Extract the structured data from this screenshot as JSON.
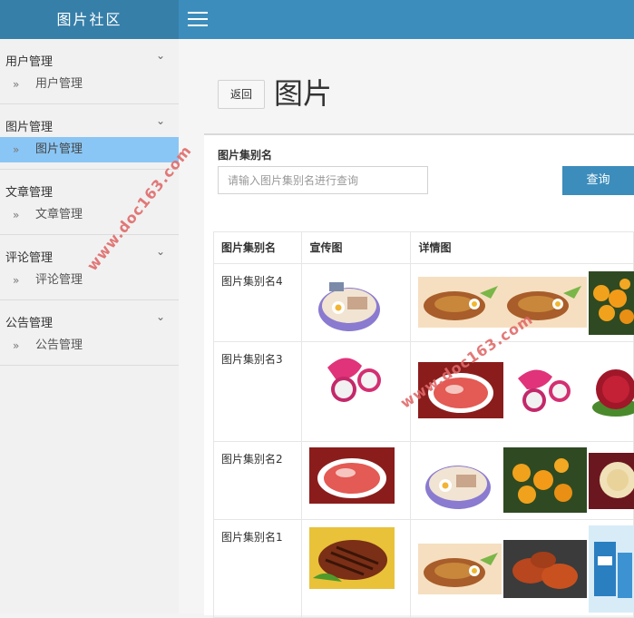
{
  "app": {
    "brand": "图片社区"
  },
  "sidebar": {
    "sections": [
      {
        "title": "用户管理",
        "item": "用户管理",
        "active": false
      },
      {
        "title": "图片管理",
        "item": "图片管理",
        "active": true
      },
      {
        "title": "文章管理",
        "item": "文章管理",
        "active": false
      },
      {
        "title": "评论管理",
        "item": "评论管理",
        "active": false
      },
      {
        "title": "公告管理",
        "item": "公告管理",
        "active": false
      }
    ]
  },
  "main": {
    "back_label": "返回",
    "title": "图片",
    "search": {
      "label": "图片集别名",
      "placeholder": "请输入图片集别名进行查询",
      "button": "查询"
    },
    "table": {
      "headers": [
        "图片集别名",
        "宣传图",
        "详情图"
      ],
      "rows": [
        {
          "name": "图片集别名4",
          "cover": "ramen",
          "details": [
            "fried-rice",
            "fried-rice",
            "oranges"
          ]
        },
        {
          "name": "图片集别名3",
          "cover": "dragonfruit",
          "details": [
            "sliced-meat",
            "dragonfruit",
            "rambutan"
          ]
        },
        {
          "name": "图片集别名2",
          "cover": "sliced-meat",
          "details": [
            "ramen",
            "oranges",
            "dessert"
          ]
        },
        {
          "name": "图片集别名1",
          "cover": "steak",
          "details": [
            "fried-rice",
            "crabs",
            "cosmetics"
          ]
        }
      ]
    }
  },
  "watermark": "www.doc163.com"
}
